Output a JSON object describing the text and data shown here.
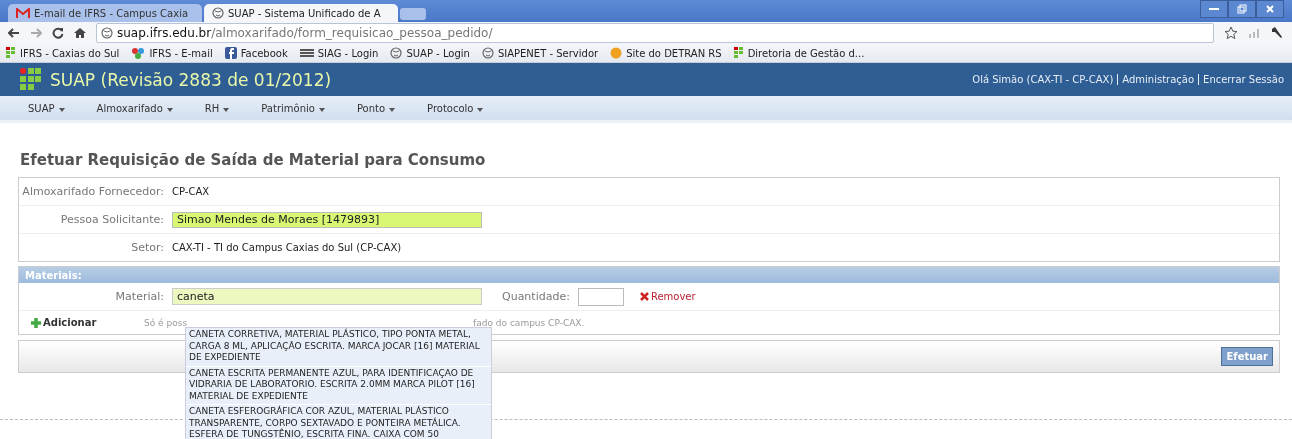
{
  "browser": {
    "tabs": [
      {
        "title": "E-mail de IFRS - Campus Caxia",
        "kind": "mail",
        "selected": false
      },
      {
        "title": "SUAP - Sistema Unificado de A",
        "kind": "globe",
        "selected": true
      }
    ],
    "url_host": "suap.ifrs.edu.br",
    "url_path": "/almoxarifado/form_requisicao_pessoa_pedido/",
    "bookmarks": [
      {
        "label": "IFRS - Caxias do Sul",
        "kind": "ifrs"
      },
      {
        "label": "IFRS - E-mail",
        "kind": "google"
      },
      {
        "label": "Facebook",
        "kind": "facebook"
      },
      {
        "label": "SIAG - Login",
        "kind": "siag"
      },
      {
        "label": "SUAP - Login",
        "kind": "globe"
      },
      {
        "label": "SIAPENET - Servidor",
        "kind": "globe"
      },
      {
        "label": "Site do DETRAN RS",
        "kind": "detran"
      },
      {
        "label": "Diretoria de Gestão d...",
        "kind": "ifrs"
      }
    ]
  },
  "header": {
    "title": "SUAP (Revisão 2883 de 01/2012)",
    "user": "Olá Simão (CAX-TI - CP-CAX)",
    "links": [
      "Administração",
      "Encerrar Sessão"
    ]
  },
  "menu": [
    "SUAP",
    "Almoxarifado",
    "RH",
    "Patrimônio",
    "Ponto",
    "Protocolo"
  ],
  "page_title": "Efetuar Requisição de Saída de Material para Consumo",
  "fields": [
    {
      "label": "Almoxarifado Fornecedor:",
      "value": "CP-CAX",
      "kind": "text"
    },
    {
      "label": "Pessoa Solicitante:",
      "value": "Simao Mendes de Moraes [1479893]",
      "kind": "input"
    },
    {
      "label": "Setor:",
      "value": "CAX-TI - TI do Campus Caxias do Sul (CP-CAX)",
      "kind": "text"
    }
  ],
  "materials": {
    "title": "Materiais:",
    "material_label": "Material:",
    "material_value": "caneta",
    "quantity_label": "Quantidade:",
    "remove": "Remover",
    "add": "Adicionar",
    "hint_start": "Só é poss",
    "hint_end": "fado do campus CP-CAX.",
    "suggestions": [
      "CANETA CORRETIVA, MATERIAL PLÁSTICO, TIPO PONTA METAL, CARGA 8 ML, APLICAÇÃO ESCRITA. MARCA JOCAR [16] MATERIAL DE EXPEDIENTE",
      "CANETA ESCRITA PERMANENTE AZUL, PARA IDENTIFICAÇAO DE VIDRARIA DE LABORATORIO. ESCRITA 2.0MM MARCA PILOT [16] MATERIAL DE EXPEDIENTE",
      "CANETA ESFEROGRÁFICA COR AZUL, MATERIAL PLÁSTICO TRANSPARENTE, CORPO SEXTAVADO E PONTEIRA METÁLICA. ESFERA DE TUNGSTÊNIO, ESCRITA FINA. CAIXA COM 50"
    ]
  },
  "submit": "Efetuar"
}
